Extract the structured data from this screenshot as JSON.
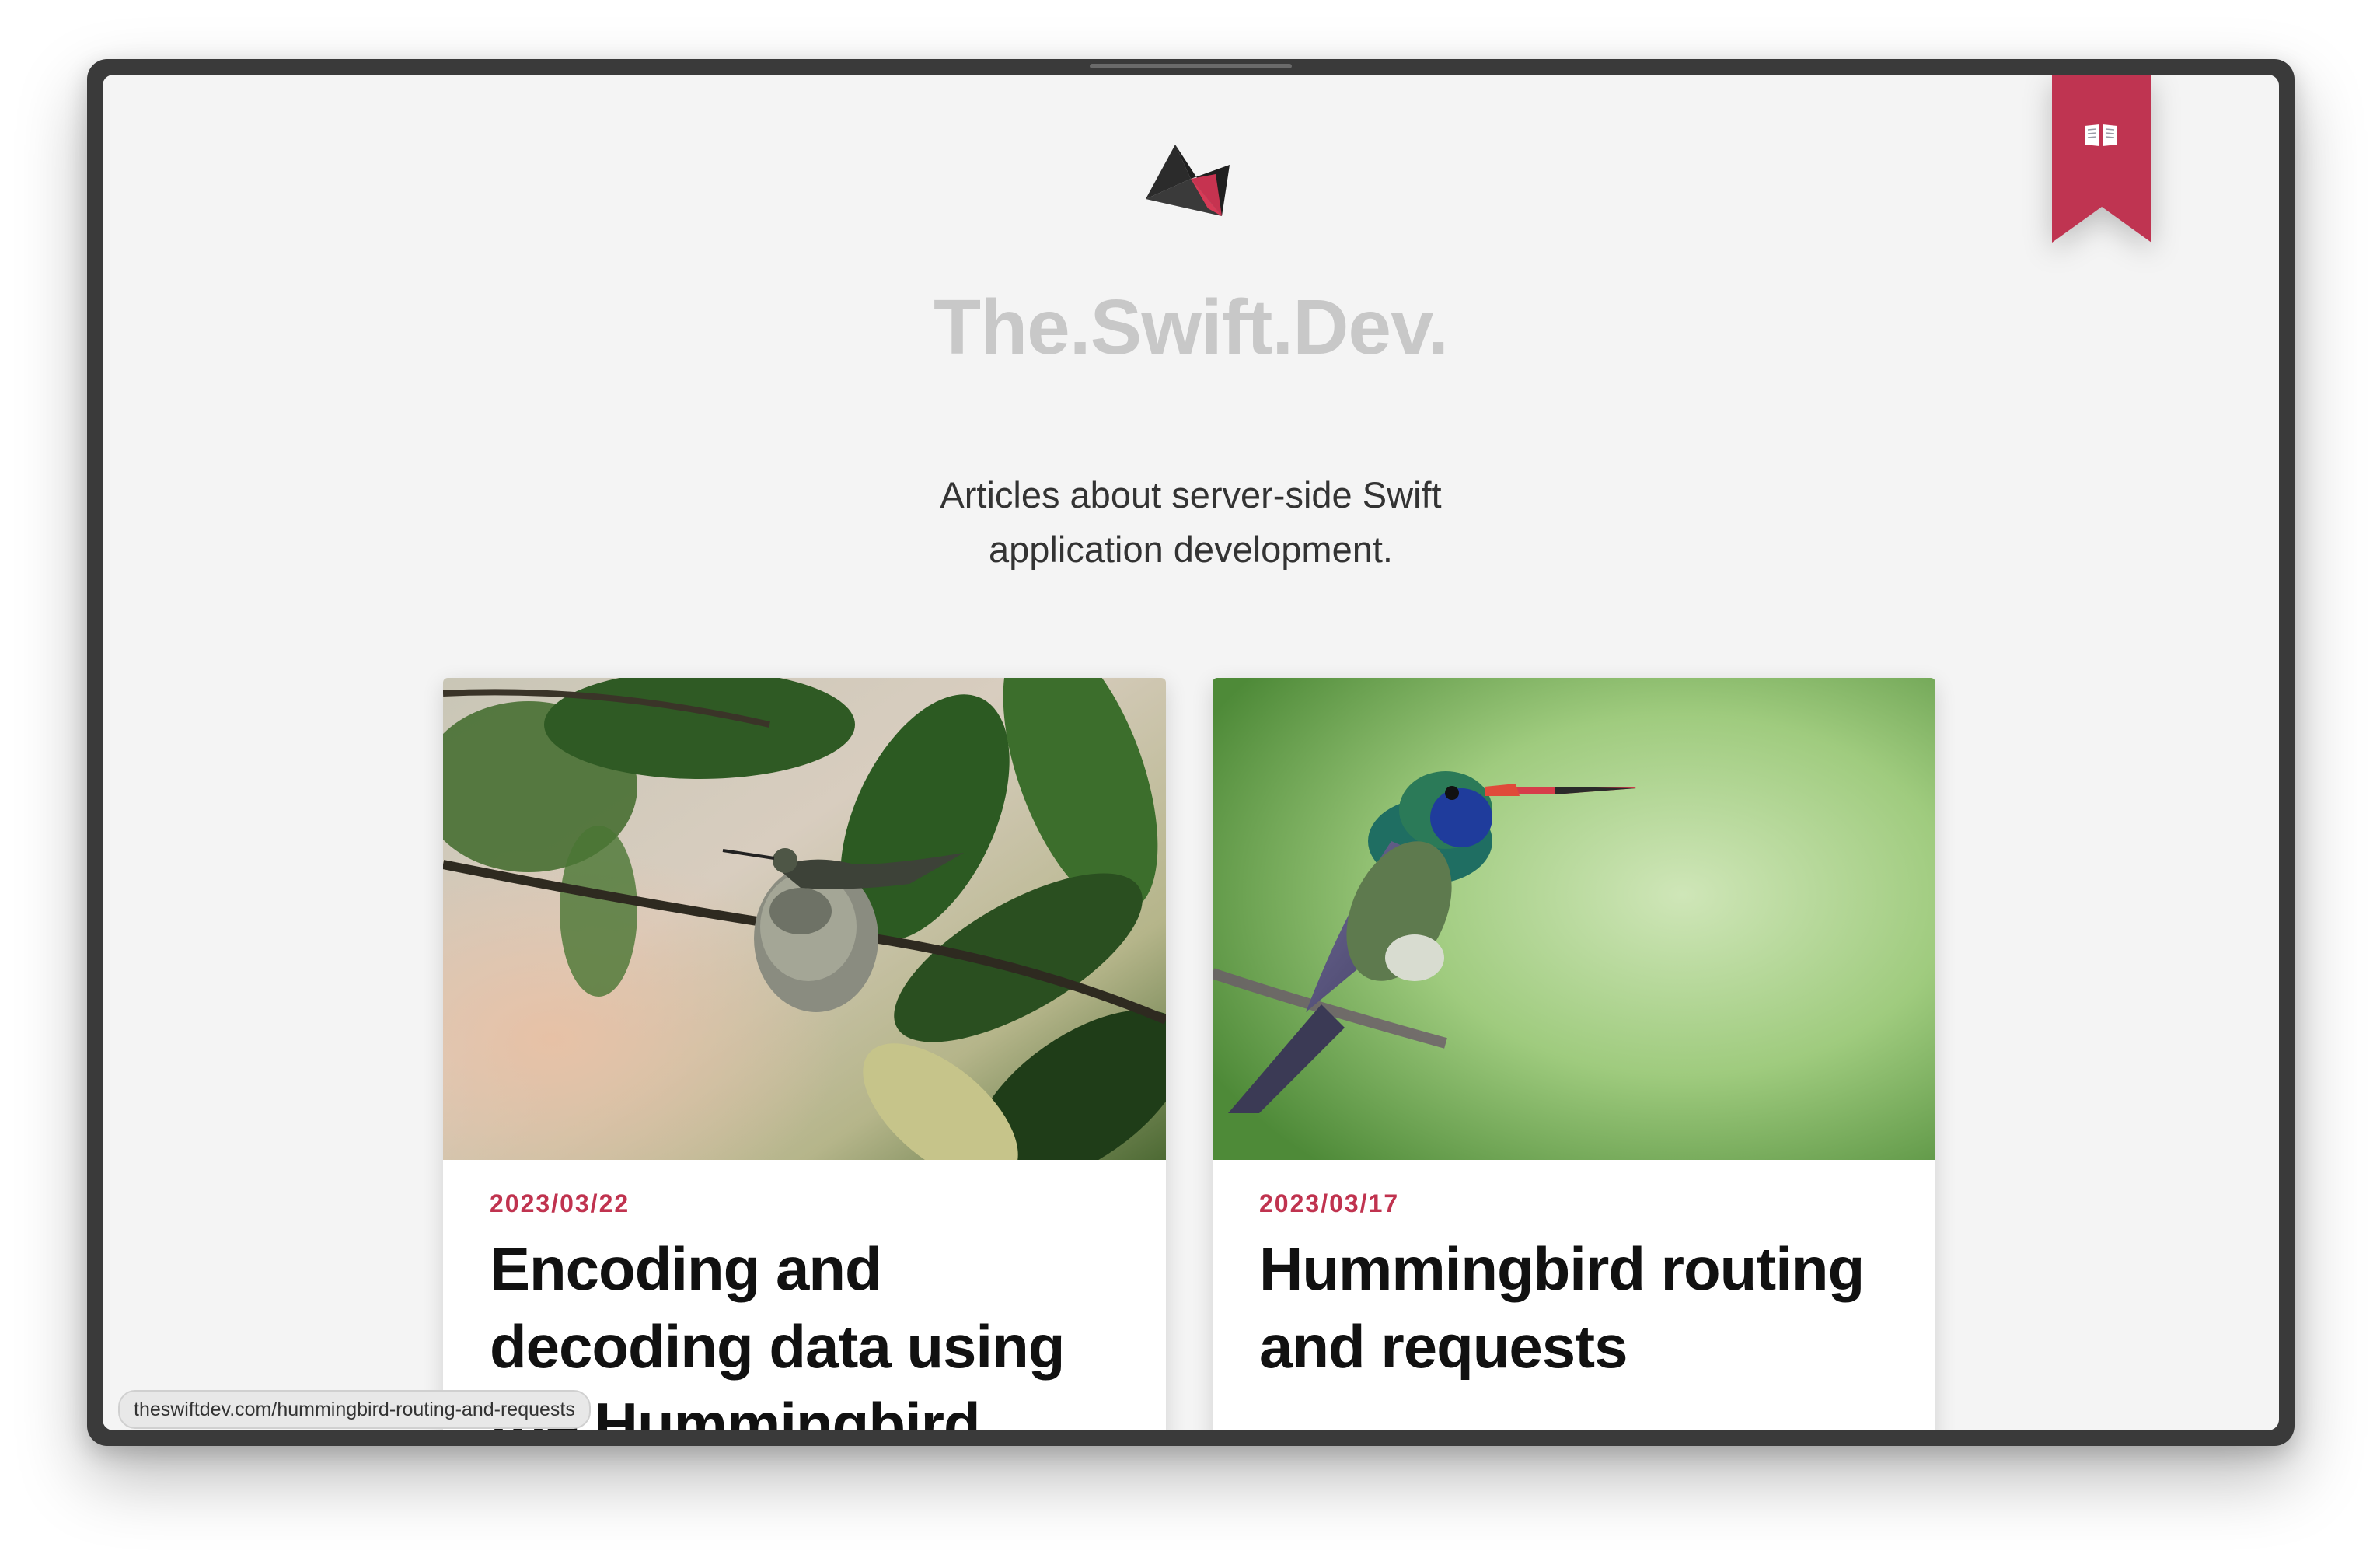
{
  "site": {
    "title": "The.Swift.Dev.",
    "tagline_line1": "Articles about server-side Swift",
    "tagline_line2": "application development."
  },
  "logo": {
    "icon": "swiftdev-logo-icon"
  },
  "bookmark": {
    "icon": "open-book-icon",
    "color": "#bf3451"
  },
  "articles": [
    {
      "date": "2023/03/22",
      "title": "Encoding and decoding data using the Hummingbird",
      "image": "hummingbird-nest-image"
    },
    {
      "date": "2023/03/17",
      "title": "Hummingbird routing and requests",
      "image": "hummingbird-perched-image"
    }
  ],
  "status_bar": {
    "url": "theswiftdev.com/hummingbird-routing-and-requests"
  },
  "colors": {
    "accent": "#c0334f",
    "background": "#f4f4f4",
    "title_gray": "#c8c8c8"
  }
}
